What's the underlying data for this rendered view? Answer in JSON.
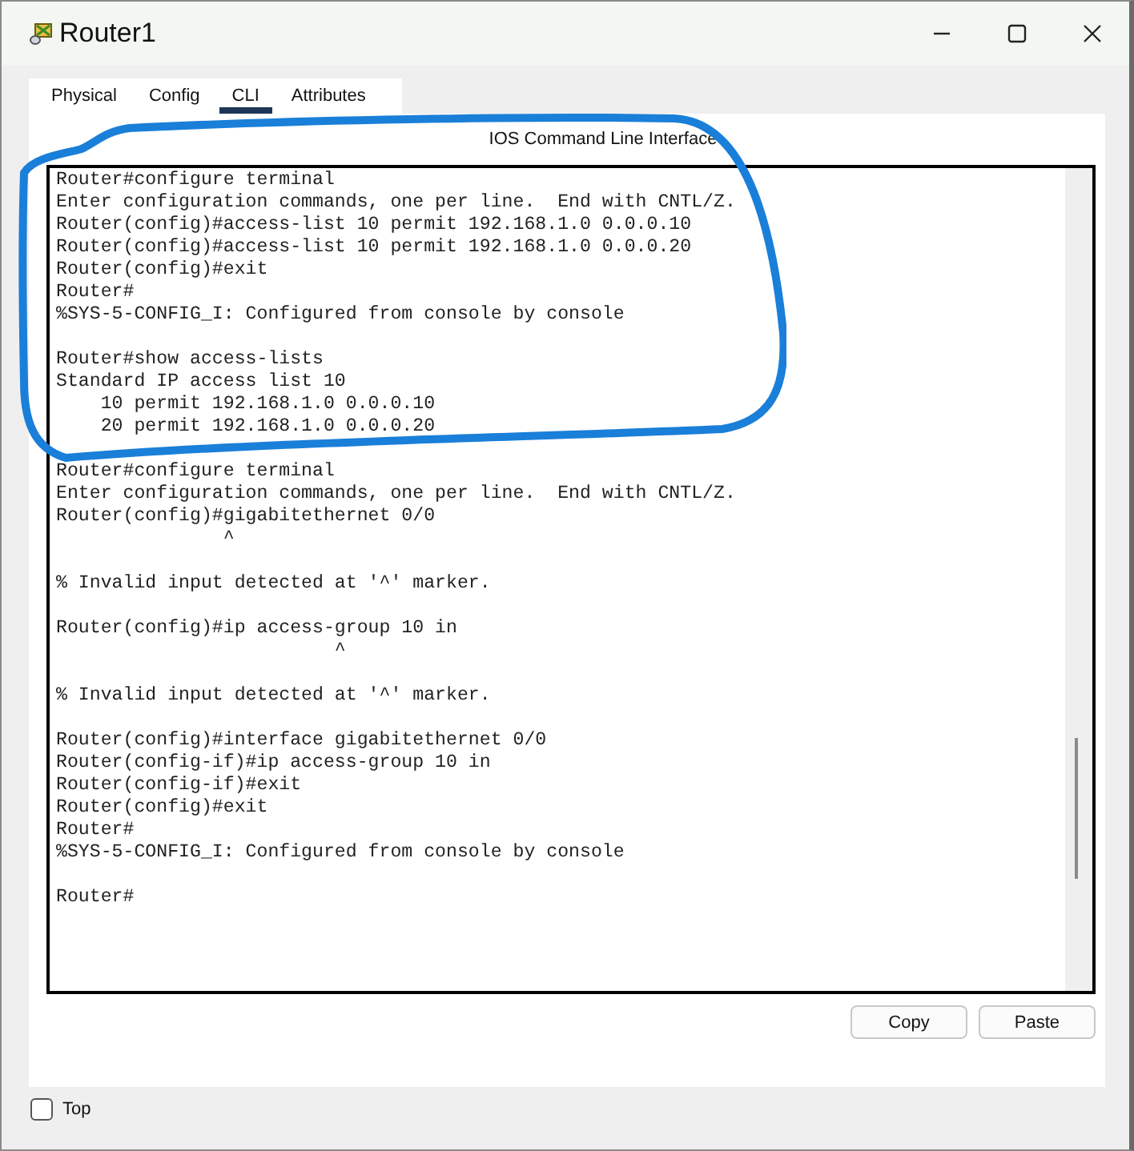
{
  "window": {
    "title": "Router1"
  },
  "tabs": [
    {
      "label": "Physical",
      "selected": false
    },
    {
      "label": "Config",
      "selected": false
    },
    {
      "label": "CLI",
      "selected": true
    },
    {
      "label": "Attributes",
      "selected": false
    }
  ],
  "panel_title": "IOS Command Line Interface",
  "terminal": {
    "blocks": [
      [
        "Router#configure terminal",
        "Enter configuration commands, one per line.  End with CNTL/Z.",
        "Router(config)#access-list 10 permit 192.168.1.0 0.0.0.10",
        "Router(config)#access-list 10 permit 192.168.1.0 0.0.0.20",
        "Router(config)#exit",
        "Router#",
        "%SYS-5-CONFIG_I: Configured from console by console"
      ],
      [
        "Router#show access-lists",
        "Standard IP access list 10",
        "    10 permit 192.168.1.0 0.0.0.10",
        "    20 permit 192.168.1.0 0.0.0.20"
      ],
      [
        "Router#configure terminal",
        "Enter configuration commands, one per line.  End with CNTL/Z.",
        "Router(config)#gigabitethernet 0/0",
        "               ^"
      ],
      [
        "% Invalid input detected at '^' marker."
      ],
      [
        "Router(config)#ip access-group 10 in",
        "                         ^"
      ],
      [
        "% Invalid input detected at '^' marker."
      ],
      [
        "Router(config)#interface gigabitethernet 0/0",
        "Router(config-if)#ip access-group 10 in",
        "Router(config-if)#exit",
        "Router(config)#exit",
        "Router#",
        "%SYS-5-CONFIG_I: Configured from console by console"
      ],
      [
        "Router#"
      ]
    ]
  },
  "buttons": [
    "Copy",
    "Paste"
  ],
  "always_on_top": {
    "label": "Top",
    "checked": false
  }
}
